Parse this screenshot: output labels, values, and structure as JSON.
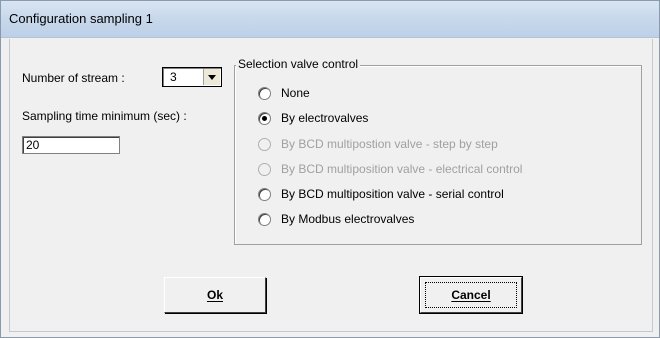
{
  "window": {
    "title": "Configuration sampling 1"
  },
  "form": {
    "stream_label": "Number of stream :",
    "stream_value": "3",
    "sampling_label": "Sampling time minimum (sec) :",
    "sampling_value": "20"
  },
  "valve_group": {
    "legend": "Selection valve control",
    "options": [
      {
        "label": "None",
        "selected": false,
        "enabled": true
      },
      {
        "label": "By electrovalves",
        "selected": true,
        "enabled": true
      },
      {
        "label": "By BCD multipostion valve - step by step",
        "selected": false,
        "enabled": false
      },
      {
        "label": "By BCD multiposition valve - electrical control",
        "selected": false,
        "enabled": false
      },
      {
        "label": "By BCD multiposition valve - serial control",
        "selected": false,
        "enabled": true
      },
      {
        "label": "By Modbus electrovalves",
        "selected": false,
        "enabled": true
      }
    ]
  },
  "buttons": {
    "ok_label": "Ok",
    "cancel_label": "Cancel"
  }
}
